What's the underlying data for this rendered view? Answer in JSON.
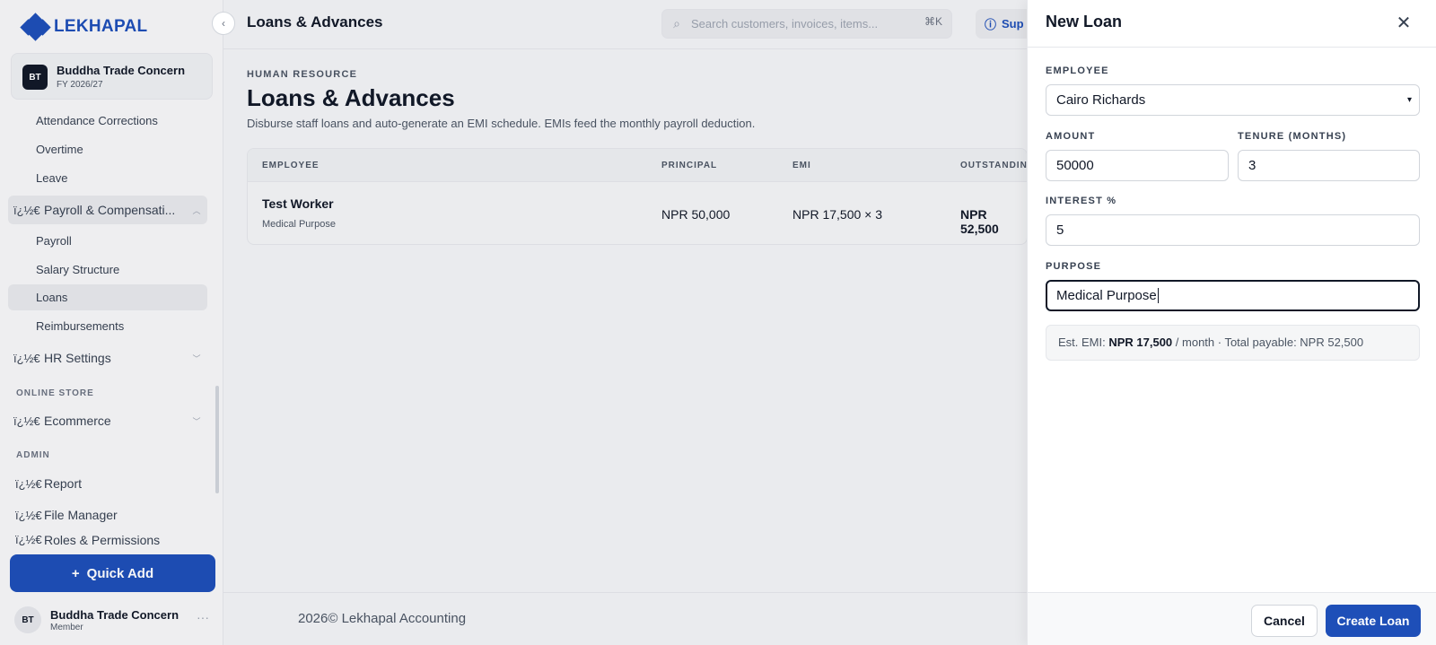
{
  "brand": {
    "name": "LEKHAPAL"
  },
  "org": {
    "initials": "BT",
    "name": "Buddha Trade Concern",
    "fy": "FY 2026/27"
  },
  "sidebar": {
    "hr_sub_top": [
      "Attendance Corrections",
      "Overtime",
      "Leave"
    ],
    "payroll_group": {
      "label": "Payroll & Compensati...",
      "icon_text": "ï¿½€"
    },
    "payroll_sub": [
      "Payroll",
      "Salary Structure",
      "Loans",
      "Reimbursements"
    ],
    "hr_settings": {
      "label": "HR Settings",
      "icon_text": "ï¿½€"
    },
    "online_store_label": "ONLINE STORE",
    "ecommerce": {
      "label": "Ecommerce",
      "icon_text": "ï¿½€"
    },
    "admin_label": "ADMIN",
    "admin_items": [
      {
        "label": "Report",
        "icon_text": "ï¿½€"
      },
      {
        "label": "File Manager",
        "icon_text": "ï¿½€"
      },
      {
        "label": "Roles & Permissions",
        "icon_text": "ï¿½€"
      }
    ],
    "quick_add": "Quick Add"
  },
  "user": {
    "initials": "BT",
    "name": "Buddha Trade Concern",
    "role": "Member"
  },
  "topbar": {
    "title": "Loans & Advances",
    "search_placeholder": "Search customers, invoices, items...",
    "search_shortcut": "⌘K",
    "support": "Sup"
  },
  "page": {
    "breadcrumb": "HUMAN RESOURCE",
    "heading": "Loans & Advances",
    "description": "Disburse staff loans and auto-generate an EMI schedule. EMIs feed the monthly payroll deduction."
  },
  "table": {
    "headers": [
      "EMPLOYEE",
      "PRINCIPAL",
      "EMI",
      "OUTSTANDING"
    ],
    "rows": [
      {
        "employee": "Test Worker",
        "purpose": "Medical Purpose",
        "principal": "NPR 50,000",
        "emi": "NPR 17,500 × 3",
        "outstanding": "NPR 52,500"
      }
    ]
  },
  "footer": {
    "text": "2026© Lekhapal Accounting"
  },
  "modal": {
    "title": "New Loan",
    "employee_label": "EMPLOYEE",
    "employee_value": "Cairo Richards",
    "amount_label": "AMOUNT",
    "amount_value": "50000",
    "tenure_label": "TENURE (MONTHS)",
    "tenure_value": "3",
    "interest_label": "INTEREST %",
    "interest_value": "5",
    "purpose_label": "PURPOSE",
    "purpose_value": "Medical Purpose",
    "est_prefix": "Est. EMI: ",
    "est_emi": "NPR 17,500",
    "est_suffix": " / month · Total payable: NPR 52,500",
    "cancel": "Cancel",
    "create": "Create Loan"
  },
  "colors": {
    "accent": "#1e4fb8"
  }
}
